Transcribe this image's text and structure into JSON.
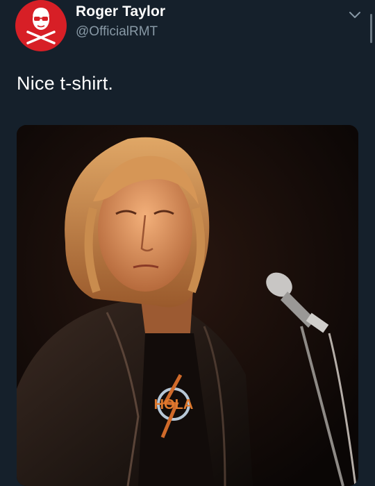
{
  "tweet": {
    "author_name": "Roger Taylor",
    "author_handle": "@OfficialRMT",
    "text": "Nice t-shirt.",
    "avatar_icon": "skull-crossbones-icon",
    "menu_icon": "chevron-down-icon",
    "media": {
      "kind": "photo",
      "shirt_print": "HOLA"
    }
  },
  "colors": {
    "background": "#15202b",
    "name": "#ffffff",
    "handle": "#8899a6",
    "avatar": "#d71f26"
  }
}
